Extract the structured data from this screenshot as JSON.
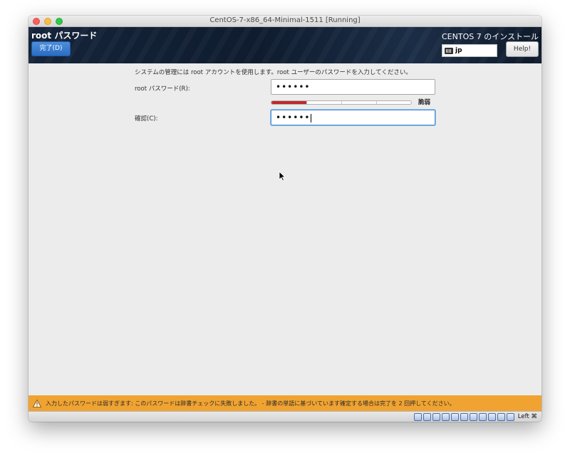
{
  "window": {
    "title": "CentOS-7-x86_64-Minimal-1511 [Running]"
  },
  "header": {
    "spoke_title": "root パスワード",
    "done_label": "完了(D)",
    "product_title": "CENTOS 7 のインストール",
    "keyboard_layout": "jp",
    "help_label": "Help!"
  },
  "form": {
    "intro": "システムの管理には root アカウントを使用します。root ユーザーのパスワードを入力してください。",
    "password_label": "root パスワード(R):",
    "password_value": "••••••",
    "strength_label": "脆弱",
    "strength_fraction": 0.25,
    "confirm_label": "確認(C):",
    "confirm_value": "••••••"
  },
  "warning": {
    "message": "入力したパスワードは弱すぎます: このパスワードは辞書チェックに失敗しました。 - 辞書の単語に基づいています確定する場合は完了を 2 回押してください。"
  },
  "statusbar": {
    "host_key": "Left ⌘",
    "icons": [
      "hard-disk-icon",
      "optical-drive-icon",
      "usb-icon",
      "shared-folder-icon",
      "display-icon",
      "network-icon",
      "capture-icon",
      "recording-icon",
      "mouse-integration-icon",
      "cpu-icon",
      "keyboard-capture-icon"
    ]
  },
  "colors": {
    "accent_blue": "#2b6cc4",
    "warning_orange": "#f0a331",
    "strength_red": "#c0292b"
  }
}
